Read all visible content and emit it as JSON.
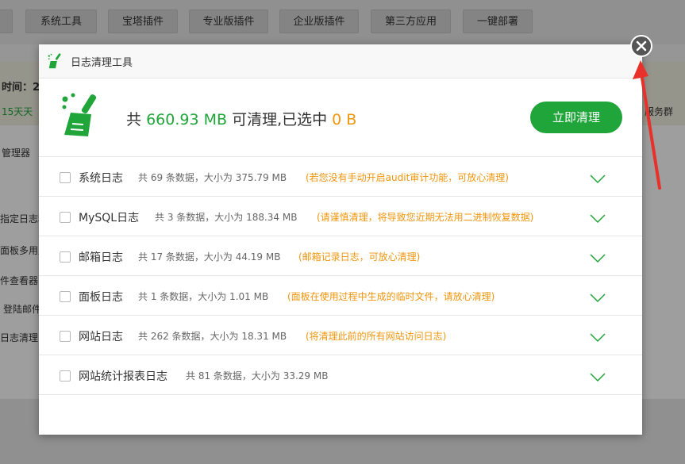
{
  "background": {
    "tabs": [
      "系统工具",
      "宝塔插件",
      "专业版插件",
      "企业版插件",
      "第三方应用",
      "一键部署"
    ],
    "left_fragments": [
      "时间：2",
      "15天天",
      "管理器",
      "指定日志和",
      "面板多用户",
      "件查看器,",
      "登陆邮件",
      "日志清理,少"
    ],
    "right_fragment": "服务群"
  },
  "dialog": {
    "title": "日志清理工具",
    "summary": {
      "prefix": "共",
      "total": "660.93 MB",
      "middle": "可清理,已选中",
      "selected": "0 B"
    },
    "clean_button": "立即清理",
    "rows": [
      {
        "name": "系统日志",
        "count": "共 69 条数据，大小为 375.79 MB",
        "note": "(若您没有手动开启audit审计功能，可放心清理)"
      },
      {
        "name": "MySQL日志",
        "count": "共 3 条数据，大小为 188.34 MB",
        "note": "(请谨慎清理，将导致您近期无法用二进制恢复数据)"
      },
      {
        "name": "邮箱日志",
        "count": "共 17 条数据，大小为 44.19 MB",
        "note": "(邮箱记录日志，可放心清理)"
      },
      {
        "name": "面板日志",
        "count": "共 1 条数据，大小为 1.01 MB",
        "note": "(面板在使用过程中生成的临时文件，请放心清理)"
      },
      {
        "name": "网站日志",
        "count": "共 262 条数据，大小为 18.31 MB",
        "note": "(将清理此前的所有网站访问日志)"
      },
      {
        "name": "网站统计报表日志",
        "count": "共 81 条数据，大小为 33.29 MB",
        "note": ""
      }
    ]
  },
  "colors": {
    "accent": "#20a53a",
    "warning": "#f0950c",
    "arrow": "#e8312a"
  },
  "icons": {
    "header": "broom-icon",
    "summary": "broom-icon",
    "close": "close-icon",
    "row_toggle": "chevron-down-icon"
  }
}
